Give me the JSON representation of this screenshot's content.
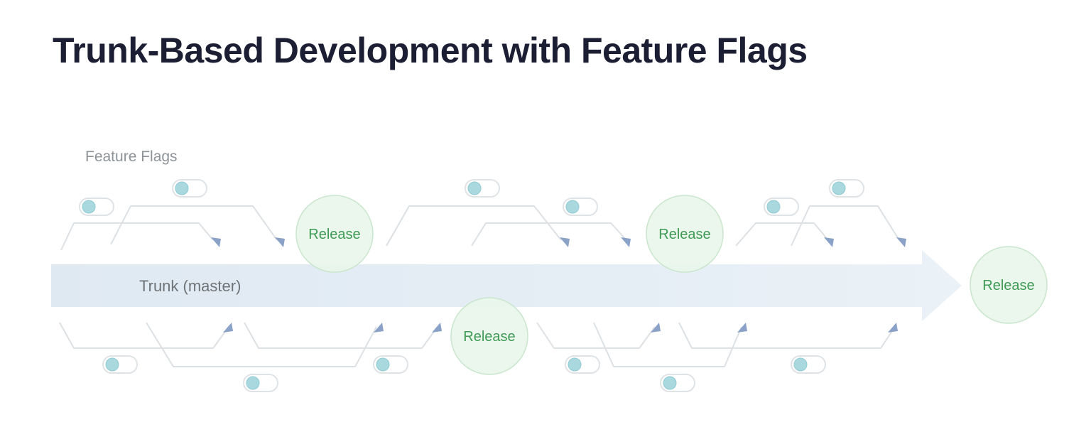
{
  "title": "Trunk-Based Development with Feature Flags",
  "diagram": {
    "feature_flags_label": "Feature Flags",
    "trunk_label": "Trunk (master)",
    "release_label": "Release",
    "colors": {
      "trunk": "#e6eef5",
      "release_fill": "#e9f6ea",
      "release_stroke": "#c9e6cd",
      "release_text": "#3f9a56",
      "arrow": "#8aa2c8",
      "branch_line": "#dde1e4",
      "toggle_knob": "#a9d8de"
    }
  }
}
